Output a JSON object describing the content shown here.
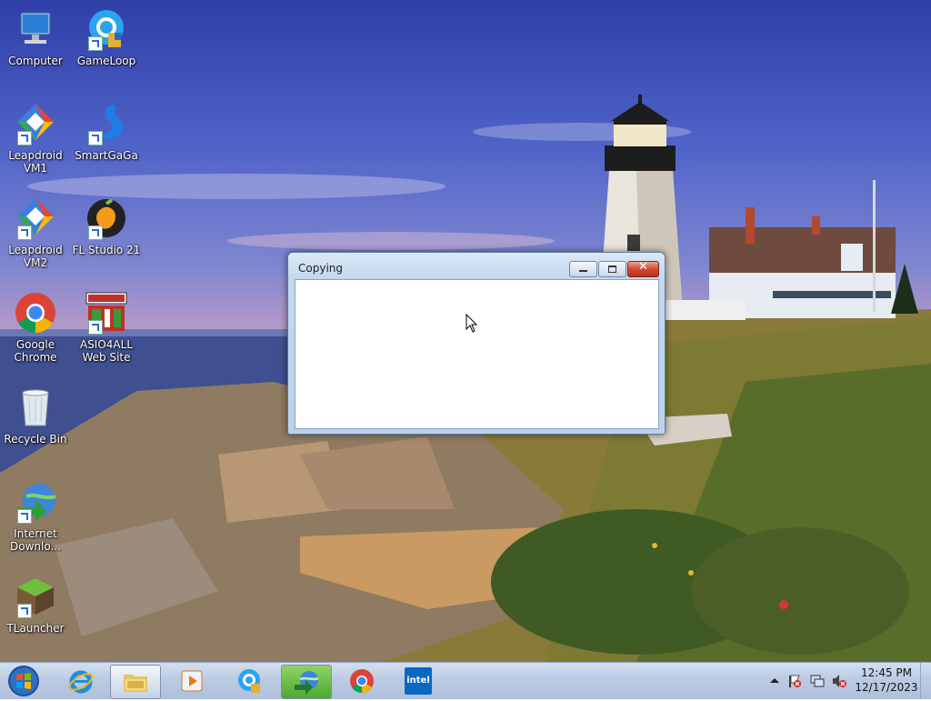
{
  "desktop": {
    "icons": [
      {
        "label": "Computer",
        "icon": "computer-icon"
      },
      {
        "label": "GameLoop",
        "icon": "gameloop-icon"
      },
      {
        "label": "Leapdroid VM1",
        "icon": "leapdroid-icon"
      },
      {
        "label": "SmartGaGa",
        "icon": "smartgaga-icon"
      },
      {
        "label": "Leapdroid VM2",
        "icon": "leapdroid-icon"
      },
      {
        "label": "FL Studio 21",
        "icon": "fl-studio-icon"
      },
      {
        "label": "Google Chrome",
        "icon": "chrome-icon"
      },
      {
        "label": "ASIO4ALL Web Site",
        "icon": "asio4all-icon"
      },
      {
        "label": "Recycle Bin",
        "icon": "recycle-bin-icon"
      },
      {
        "label": "Internet Downlo...",
        "icon": "internet-download-manager-icon"
      },
      {
        "label": "TLauncher",
        "icon": "tlauncher-icon"
      }
    ]
  },
  "window": {
    "title": "Copying",
    "controls": {
      "minimize": "minimize",
      "maximize": "maximize",
      "close": "close"
    },
    "close_glyph": "✕"
  },
  "taskbar": {
    "start": "start-orb-icon",
    "items": [
      {
        "name": "internet-explorer-icon"
      },
      {
        "name": "file-explorer-icon",
        "active": true
      },
      {
        "name": "media-player-icon"
      },
      {
        "name": "gameloop-icon"
      },
      {
        "name": "internet-download-manager-icon",
        "active": true
      },
      {
        "name": "chrome-icon"
      },
      {
        "name": "intel-icon",
        "label": "intel"
      }
    ],
    "tray": {
      "icons": [
        "show-hidden-icons-chevron",
        "action-center-flag-icon",
        "network-icon",
        "volume-muted-icon"
      ],
      "time": "12:45 PM",
      "date": "12/17/2023"
    }
  },
  "colors": {
    "taskbar": "#bccbe3",
    "close_button": "#cf4b32",
    "sky": "#4f63c8"
  }
}
